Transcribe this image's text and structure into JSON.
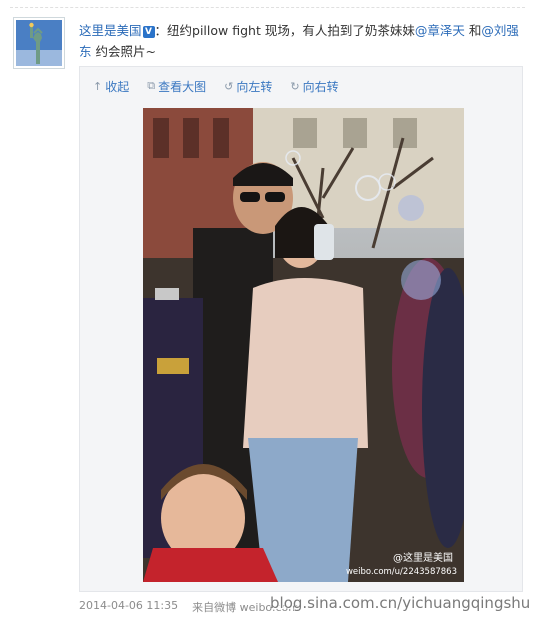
{
  "post": {
    "author": "这里是美国",
    "author_badge": "V",
    "text_part1": "：纽约pillow fight 现场，有人拍到了奶茶妹妹",
    "mention1": "@章泽天",
    "connector": " 和",
    "mention2": "@刘强东",
    "text_part2": " 约会照片~"
  },
  "toolbar": {
    "collapse_label": "收起",
    "collapse_icon": "↑",
    "view_large_label": "查看大图",
    "view_large_icon": "⧉",
    "rotate_left_label": "向左转",
    "rotate_left_icon": "↺",
    "rotate_right_label": "向右转",
    "rotate_right_icon": "↻"
  },
  "photo": {
    "watermark_logo": "@这里是美国",
    "watermark_url": "weibo.com/u/2243587863"
  },
  "footer": {
    "timestamp": "2014-04-06 11:35",
    "source": "来自微博 weibo.com"
  },
  "page_watermark": "blog.sina.com.cn/yichuangqingshu"
}
